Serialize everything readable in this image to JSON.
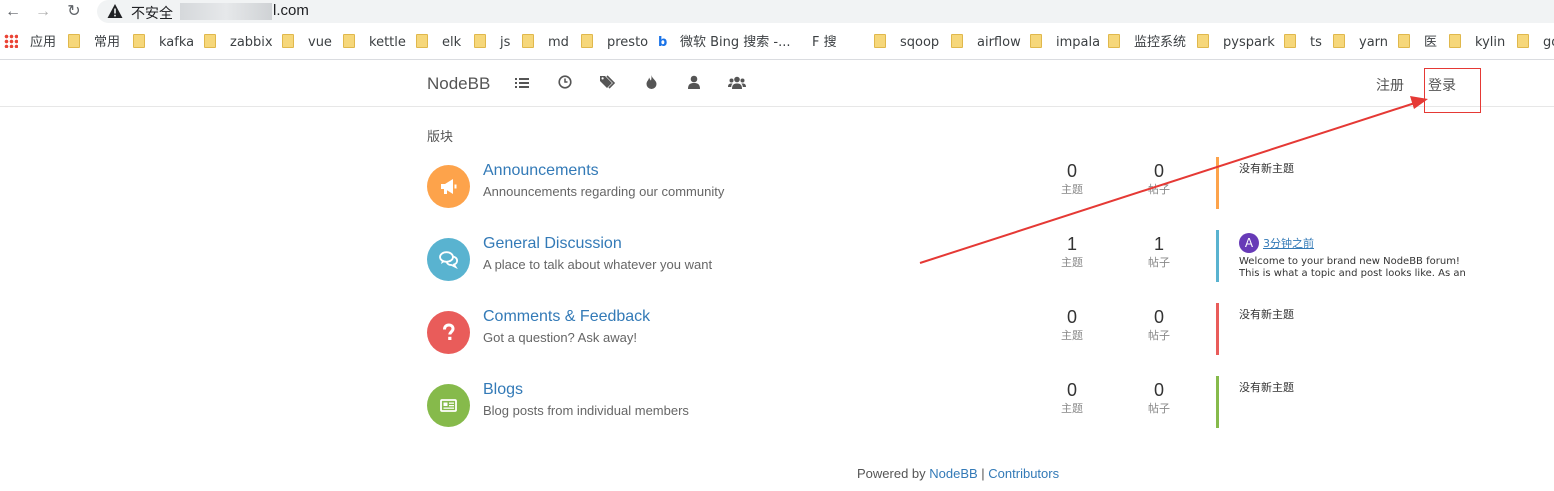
{
  "browser": {
    "insecure_label": "不安全",
    "url_tail": "l.com",
    "bookmarks": [
      {
        "label": "应用",
        "icon": "apps-grid-icon"
      },
      {
        "label": "常用",
        "icon": "folder-icon"
      },
      {
        "label": "kafka",
        "icon": "folder-icon"
      },
      {
        "label": "zabbix",
        "icon": "folder-icon"
      },
      {
        "label": "vue",
        "icon": "folder-icon"
      },
      {
        "label": "kettle",
        "icon": "folder-icon"
      },
      {
        "label": "elk",
        "icon": "folder-icon"
      },
      {
        "label": "js",
        "icon": "folder-icon"
      },
      {
        "label": "md",
        "icon": "folder-icon"
      },
      {
        "label": "presto",
        "icon": "folder-icon"
      },
      {
        "label": "微软 Bing 搜索 -...",
        "icon": "bing-icon"
      },
      {
        "label": "F 搜",
        "icon": "f-icon"
      },
      {
        "label": "sqoop",
        "icon": "folder-icon"
      },
      {
        "label": "airflow",
        "icon": "folder-icon"
      },
      {
        "label": "impala",
        "icon": "folder-icon"
      },
      {
        "label": "监控系统",
        "icon": "folder-icon"
      },
      {
        "label": "pyspark",
        "icon": "folder-icon"
      },
      {
        "label": "ts",
        "icon": "folder-icon"
      },
      {
        "label": "yarn",
        "icon": "folder-icon"
      },
      {
        "label": "医",
        "icon": "folder-icon"
      },
      {
        "label": "kylin",
        "icon": "folder-icon"
      },
      {
        "label": "go",
        "icon": "folder-icon"
      }
    ]
  },
  "header": {
    "brand": "NodeBB",
    "nav_icons": [
      "categories-list-icon",
      "recent-clock-icon",
      "tags-icon",
      "popular-fire-icon",
      "user-icon",
      "groups-icon"
    ],
    "register": "注册",
    "login": "登录"
  },
  "main": {
    "section_title": "版块",
    "stat_labels": {
      "topics": "主题",
      "posts": "帖子"
    },
    "empty_teaser": "没有新主题",
    "categories": [
      {
        "name": "Announcements",
        "description": "Announcements regarding our community",
        "topics": "0",
        "posts": "0",
        "icon": "bullhorn-icon",
        "color": "#fda34b",
        "teaser_bar_color": "#fda34b"
      },
      {
        "name": "General Discussion",
        "description": "A place to talk about whatever you want",
        "topics": "1",
        "posts": "1",
        "icon": "comments-icon",
        "color": "#59b3d0",
        "teaser_bar_color": "#59b3d0",
        "teaser": {
          "avatar_letter": "A",
          "time": "3分钟之前",
          "line1": "Welcome to your brand new NodeBB forum!",
          "line2": "This is what a topic and post looks like. As an"
        }
      },
      {
        "name": "Comments & Feedback",
        "description": "Got a question? Ask away!",
        "topics": "0",
        "posts": "0",
        "icon": "question-icon",
        "color": "#e95c5a",
        "teaser_bar_color": "#e95c5a"
      },
      {
        "name": "Blogs",
        "description": "Blog posts from individual members",
        "topics": "0",
        "posts": "0",
        "icon": "newspaper-icon",
        "color": "#86ba4b",
        "teaser_bar_color": "#86ba4b"
      }
    ]
  },
  "footer": {
    "powered_by": "Powered by ",
    "nodebb": "NodeBB",
    "separator": " | ",
    "contributors": "Contributors"
  },
  "colors": {
    "link": "#337ab7",
    "annotation": "#e53935"
  }
}
